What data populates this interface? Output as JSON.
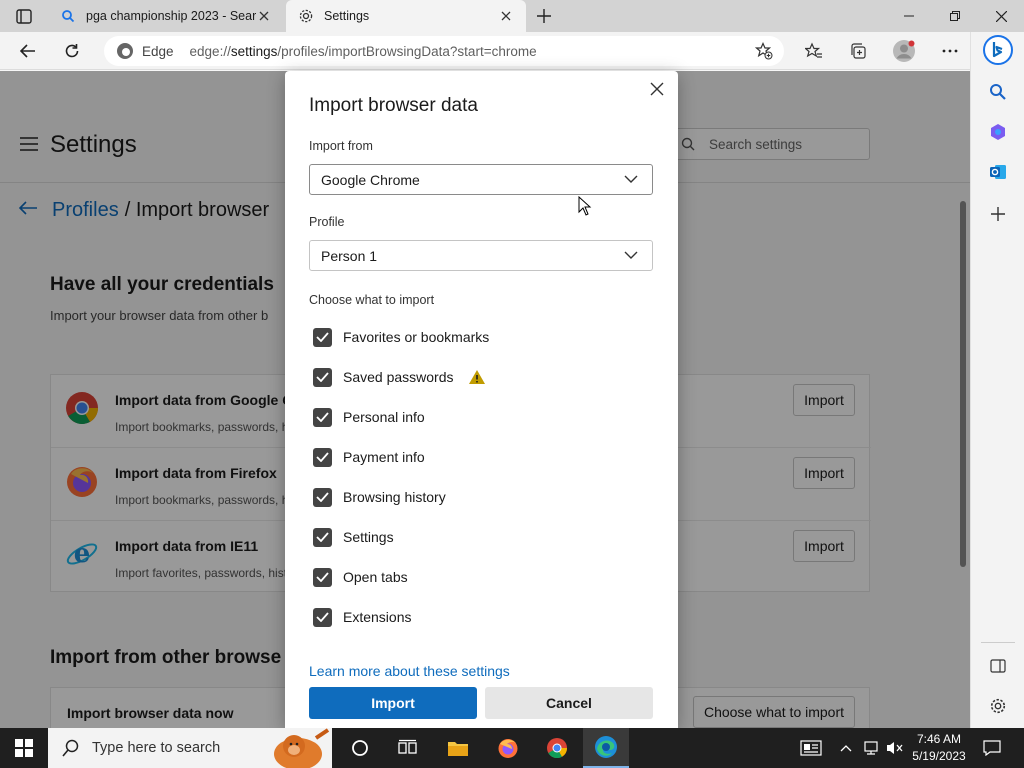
{
  "tabs": [
    {
      "title": "pga championship 2023 - Search",
      "icon": "search-icon"
    },
    {
      "title": "Settings",
      "icon": "gear-icon"
    }
  ],
  "address": {
    "site_label": "Edge",
    "url_prefix": "edge://",
    "url_host": "settings",
    "url_path": "/profiles/importBrowsingData?start=chrome"
  },
  "settings_page": {
    "title": "Settings",
    "search_placeholder": "Search settings",
    "breadcrumb_link": "Profiles",
    "breadcrumb_rest": "/ Import browser",
    "section1_title": "Have all your credentials",
    "section1_sub": "Import your browser data from other b",
    "rows": [
      {
        "title": "Import data from Google C",
        "sub": "Import bookmarks, passwords, h",
        "button": "Import"
      },
      {
        "title": "Import data from Firefox",
        "sub": "Import bookmarks, passwords, h",
        "button": "Import"
      },
      {
        "title": "Import data from IE11",
        "sub": "Import favorites, passwords, hist",
        "button": "Import"
      }
    ],
    "section2_title": "Import from other browse",
    "bottom_row_label": "Import browser data now",
    "bottom_row_button": "Choose what to import"
  },
  "dialog": {
    "title": "Import browser data",
    "import_from_label": "Import from",
    "import_from_value": "Google Chrome",
    "profile_label": "Profile",
    "profile_value": "Person 1",
    "choose_label": "Choose what to import",
    "items": [
      {
        "label": "Favorites or bookmarks",
        "checked": true
      },
      {
        "label": "Saved passwords",
        "checked": true
      },
      {
        "label": "Personal info",
        "checked": true
      },
      {
        "label": "Payment info",
        "checked": true
      },
      {
        "label": "Browsing history",
        "checked": true
      },
      {
        "label": "Settings",
        "checked": true
      },
      {
        "label": "Open tabs",
        "checked": true
      },
      {
        "label": "Extensions",
        "checked": true
      }
    ],
    "learn_more": "Learn more about these settings",
    "import_button": "Import",
    "cancel_button": "Cancel"
  },
  "taskbar": {
    "search_placeholder": "Type here to search",
    "time": "7:46 AM",
    "date": "5/19/2023"
  },
  "colors": {
    "accent": "#0f6cbd",
    "taskbar": "#1f1f1f",
    "warning": "#c19c00"
  }
}
